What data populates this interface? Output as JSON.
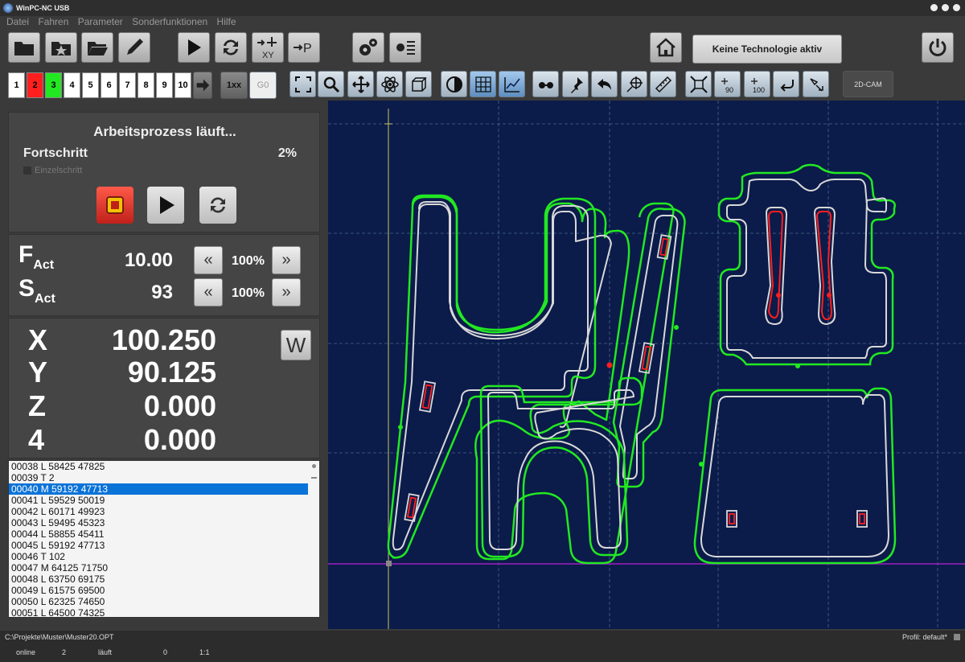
{
  "window": {
    "title": "WinPC-NC USB"
  },
  "menu": [
    "Datei",
    "Fahren",
    "Parameter",
    "Sonderfunktionen",
    "Hilfe"
  ],
  "toolbar": {
    "tech_label": "Keine Technologie aktiv",
    "scale_1xx": "1xx",
    "g0": "G0",
    "cam2d": "2D-CAM"
  },
  "tool_numbers": [
    {
      "label": "1",
      "color": "#ffffff"
    },
    {
      "label": "2",
      "color": "#ff1f1f"
    },
    {
      "label": "3",
      "color": "#22e822"
    },
    {
      "label": "4",
      "color": "#ffffff"
    },
    {
      "label": "5",
      "color": "#ffffff"
    },
    {
      "label": "6",
      "color": "#ffffff"
    },
    {
      "label": "7",
      "color": "#ffffff"
    },
    {
      "label": "8",
      "color": "#ffffff"
    },
    {
      "label": "9",
      "color": "#ffffff"
    },
    {
      "label": "10",
      "color": "#ffffff"
    }
  ],
  "process": {
    "title": "Arbeitsprozess läuft...",
    "progress_label": "Fortschritt",
    "progress": "2%",
    "single_step": "Einzelschritt"
  },
  "feed": {
    "f_label": "F",
    "s_label": "S",
    "sub": "Act",
    "f_value": "10.00",
    "s_value": "93",
    "f_pct": "100%",
    "s_pct": "100%"
  },
  "axes": [
    {
      "label": "X",
      "value": "100.250"
    },
    {
      "label": "Y",
      "value": "90.125"
    },
    {
      "label": "Z",
      "value": "0.000"
    },
    {
      "label": "4",
      "value": "0.000"
    }
  ],
  "w_button": "W",
  "gcode": [
    "00038  L 58425 47825",
    "00039  T 2",
    "00040  M 59192 47713",
    "00041  L 59529 50019",
    "00042  L 60171 49923",
    "00043  L 59495 45323",
    "00044  L 58855 45411",
    "00045  L 59192 47713",
    "00046  T 102",
    "00047  M 64125 71750",
    "00048  L 63750 69175",
    "00049  L 61575 69500",
    "00050  L 62325 74650",
    "00051  L 64500 74325"
  ],
  "gcode_selected": 2,
  "status": {
    "path": "C:\\Projekte\\Muster\\Muster20.OPT",
    "profile": "Profil: default*",
    "online": "online",
    "tool": "2",
    "state": "läuft",
    "count": "0",
    "ratio": "1:1"
  },
  "colors": {
    "canvas": "#0b1b4a",
    "contour_green": "#22e822",
    "contour_white": "#d8d8d8",
    "red": "#ff1f1f",
    "selection": "#0a73d8"
  }
}
